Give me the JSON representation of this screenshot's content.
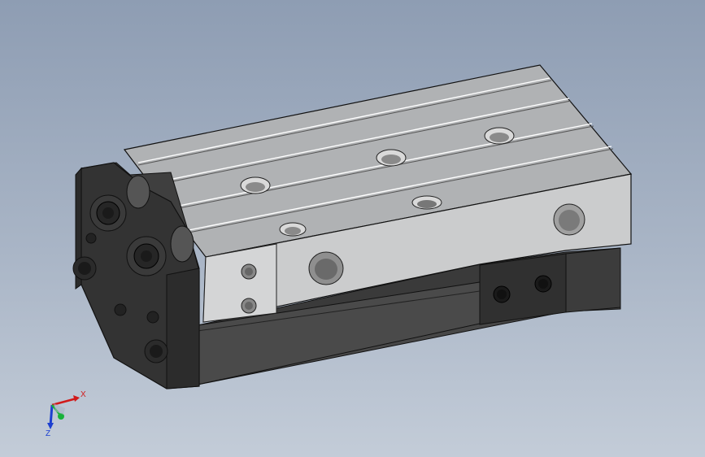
{
  "viewport": {
    "background_top": "#8e9db3",
    "background_bottom": "#c3ccd8"
  },
  "model": {
    "icon": "slide-cylinder-3d-model",
    "colors": {
      "body_top": "#b5b7b9",
      "body_side": "#c9cacb",
      "body_dark": "#3c3c3c",
      "endcap": "#323232",
      "edge": "#111111"
    }
  },
  "triad": {
    "x_label": "X",
    "z_label": "Z",
    "colors": {
      "x": "#d11a1a",
      "y": "#18b23a",
      "z": "#1c3fd0"
    }
  }
}
